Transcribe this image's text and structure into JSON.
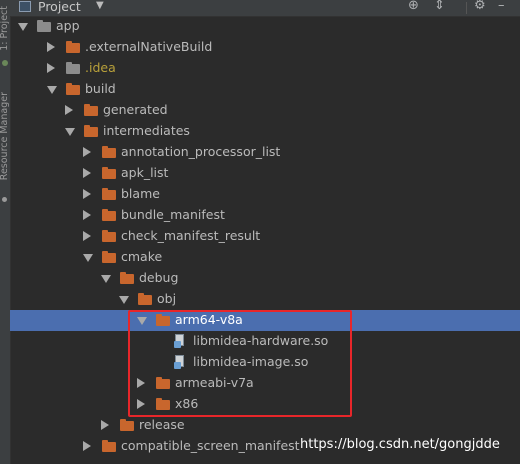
{
  "header": {
    "title": "Project"
  },
  "side_tabs": {
    "project": "1: Project",
    "resource_manager": "Resource Manager"
  },
  "tree": [
    {
      "label": "app",
      "icon": "folder-gray",
      "expanded": true
    },
    {
      "label": ".externalNativeBuild",
      "icon": "folder-orange",
      "expanded": false
    },
    {
      "label": ".idea",
      "icon": "folder-gray",
      "expanded": false
    },
    {
      "label": "build",
      "icon": "folder-orange",
      "expanded": true
    },
    {
      "label": "generated",
      "icon": "folder-orange",
      "expanded": false
    },
    {
      "label": "intermediates",
      "icon": "folder-orange",
      "expanded": true
    },
    {
      "label": "annotation_processor_list",
      "icon": "folder-orange",
      "expanded": false
    },
    {
      "label": "apk_list",
      "icon": "folder-orange",
      "expanded": false
    },
    {
      "label": "blame",
      "icon": "folder-orange",
      "expanded": false
    },
    {
      "label": "bundle_manifest",
      "icon": "folder-orange",
      "expanded": false
    },
    {
      "label": "check_manifest_result",
      "icon": "folder-orange",
      "expanded": false
    },
    {
      "label": "cmake",
      "icon": "folder-orange",
      "expanded": true
    },
    {
      "label": "debug",
      "icon": "folder-orange",
      "expanded": true
    },
    {
      "label": "obj",
      "icon": "folder-orange",
      "expanded": true
    },
    {
      "label": "arm64-v8a",
      "icon": "folder-orange",
      "expanded": true,
      "selected": true
    },
    {
      "label": "libmidea-hardware.so",
      "icon": "file-so"
    },
    {
      "label": "libmidea-image.so",
      "icon": "file-so"
    },
    {
      "label": "armeabi-v7a",
      "icon": "folder-orange",
      "expanded": false
    },
    {
      "label": "x86",
      "icon": "folder-orange",
      "expanded": false
    },
    {
      "label": "release",
      "icon": "folder-orange",
      "expanded": false
    },
    {
      "label": "compatible_screen_manifest",
      "icon": "folder-orange",
      "expanded": false
    }
  ],
  "watermark": "https://blog.csdn.net/gongjdde"
}
